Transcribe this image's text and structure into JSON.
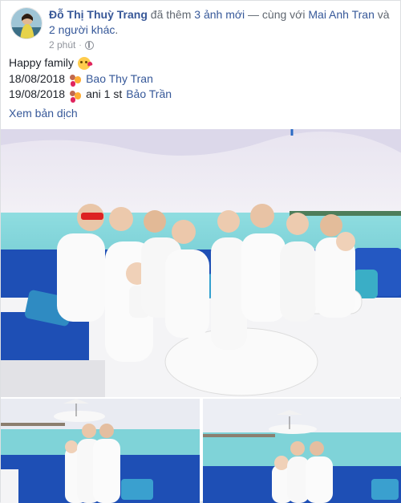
{
  "post": {
    "author": "Đỗ Thị Thuỳ Trang",
    "action_text": "đã thêm",
    "photos_link": "3 ảnh mới",
    "with_text": "— cùng với",
    "tagged_person": "Mai Anh Tran",
    "and_text": "và",
    "others_link": "2 người khác",
    "end_punct": ".",
    "time": "2 phút",
    "dot": "·",
    "privacy_icon": "globe-icon",
    "caption": {
      "line1": "Happy family",
      "line1_emoji": "kiss-icon",
      "line2_date": "18/08/2018",
      "line2_emoji": "family-icon",
      "line2_link": "Bao Thy Tran",
      "line3_date": "19/08/2018",
      "line3_emoji": "family-icon",
      "line3_text": "ani 1 st",
      "line3_link": "Bảo Trần"
    },
    "see_translation": "Xem bản dịch",
    "colors": {
      "link": "#365899",
      "name": "#385898",
      "meta": "#90949c",
      "sea": "#7fd3d8",
      "sofa": "#1e4fb5"
    }
  }
}
